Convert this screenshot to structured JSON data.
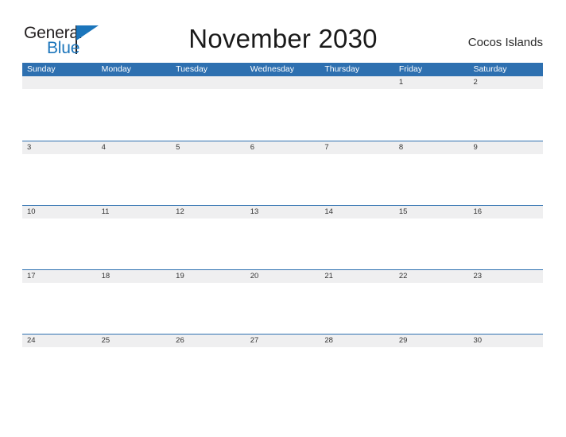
{
  "brand": {
    "name_part1": "General",
    "name_part2": "Blue",
    "flag_icon": "blue-flag-icon",
    "color_dark": "#231f20",
    "color_blue": "#1b75bb"
  },
  "header": {
    "title": "November 2030",
    "location": "Cocos Islands"
  },
  "calendar": {
    "accent_color": "#2e70b0",
    "band_color": "#efeff0",
    "weekdays": [
      "Sunday",
      "Monday",
      "Tuesday",
      "Wednesday",
      "Thursday",
      "Friday",
      "Saturday"
    ],
    "weeks": [
      [
        "",
        "",
        "",
        "",
        "",
        "1",
        "2"
      ],
      [
        "3",
        "4",
        "5",
        "6",
        "7",
        "8",
        "9"
      ],
      [
        "10",
        "11",
        "12",
        "13",
        "14",
        "15",
        "16"
      ],
      [
        "17",
        "18",
        "19",
        "20",
        "21",
        "22",
        "23"
      ],
      [
        "24",
        "25",
        "26",
        "27",
        "28",
        "29",
        "30"
      ]
    ]
  }
}
